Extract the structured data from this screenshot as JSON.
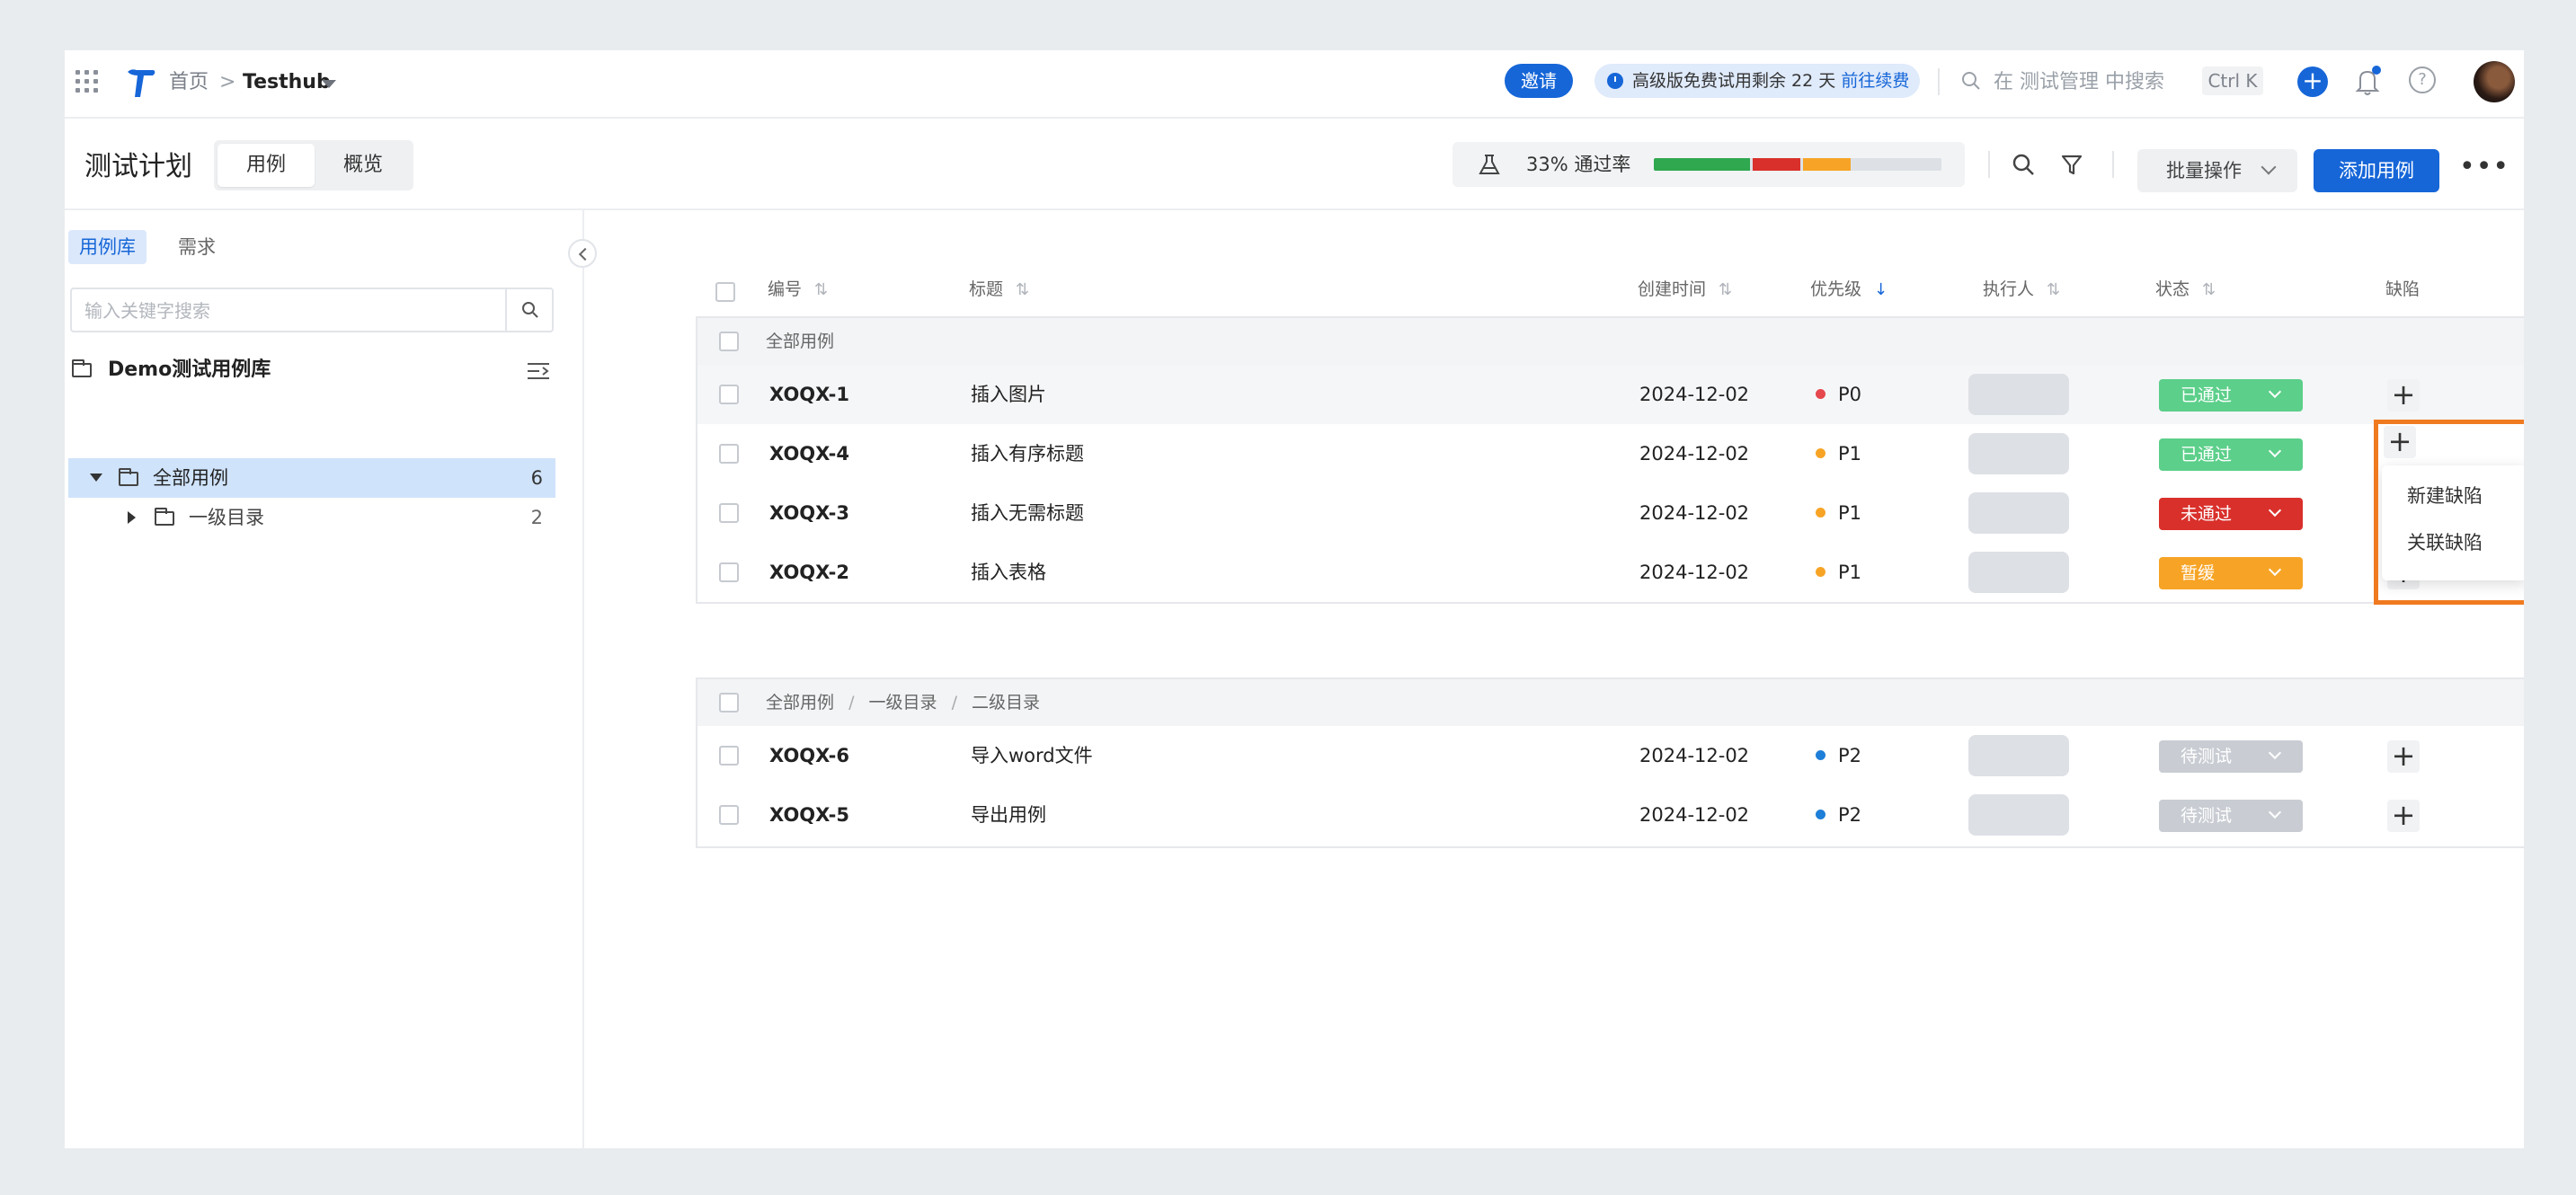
{
  "topnav": {
    "breadcrumb_home": "首页",
    "breadcrumb_sep": ">",
    "project_name": "Testhub",
    "invite_label": "邀请",
    "trial_text": "高级版免费试用剩余 22 天",
    "trial_link": "前往续费",
    "search_placeholder": "在 测试管理 中搜索",
    "shortcut": "Ctrl K",
    "help_label": "?"
  },
  "header": {
    "page_title": "测试计划",
    "tabs": [
      {
        "label": "用例",
        "active": true
      },
      {
        "label": "概览",
        "active": false
      }
    ],
    "pass_rate_label": "33% 通过率",
    "pass_rate": 0.33,
    "pass_bar": [
      {
        "status": "passed",
        "fraction": 0.333,
        "color": "#2fa84f"
      },
      {
        "status": "failed",
        "fraction": 0.167,
        "color": "#d9302b"
      },
      {
        "status": "blocked",
        "fraction": 0.167,
        "color": "#f7a426"
      },
      {
        "status": "untested",
        "fraction": 0.333,
        "color": "#dde1e6"
      }
    ],
    "batch_label": "批量操作",
    "add_label": "添加用例",
    "more_label": "•••"
  },
  "sidebar": {
    "tabs": [
      {
        "label": "用例库",
        "active": true
      },
      {
        "label": "需求",
        "active": false
      }
    ],
    "search_placeholder": "输入关键字搜索",
    "library_title": "Demo测试用例库",
    "tree": [
      {
        "label": "全部用例",
        "count": "6",
        "selected": true,
        "expanded": true
      },
      {
        "label": "一级目录",
        "count": "2",
        "selected": false,
        "expanded": false
      }
    ]
  },
  "table": {
    "columns": {
      "id": "编号",
      "title": "标题",
      "created": "创建时间",
      "priority": "优先级",
      "assignee": "执行人",
      "status": "状态",
      "defect": "缺陷"
    },
    "groups": [
      {
        "path": [
          "全部用例"
        ],
        "rows": [
          {
            "id": "XOQX-1",
            "title": "插入图片",
            "created": "2024-12-02",
            "priority": "P0",
            "priority_color": "#e5484d",
            "status": "已通过",
            "status_color": "#5ccf8a"
          },
          {
            "id": "XOQX-4",
            "title": "插入有序标题",
            "created": "2024-12-02",
            "priority": "P1",
            "priority_color": "#f7a426",
            "status": "已通过",
            "status_color": "#5ccf8a"
          },
          {
            "id": "XOQX-3",
            "title": "插入无需标题",
            "created": "2024-12-02",
            "priority": "P1",
            "priority_color": "#f7a426",
            "status": "未通过",
            "status_color": "#d9302b"
          },
          {
            "id": "XOQX-2",
            "title": "插入表格",
            "created": "2024-12-02",
            "priority": "P1",
            "priority_color": "#f7a426",
            "status": "暂缓",
            "status_color": "#f7a426"
          }
        ]
      },
      {
        "path": [
          "全部用例",
          "一级目录",
          "二级目录"
        ],
        "path_sep": "/",
        "rows": [
          {
            "id": "XOQX-6",
            "title": "导入word文件",
            "created": "2024-12-02",
            "priority": "P2",
            "priority_color": "#1e7fd8",
            "status": "待测试",
            "status_color": "#c9cdd3"
          },
          {
            "id": "XOQX-5",
            "title": "导出用例",
            "created": "2024-12-02",
            "priority": "P2",
            "priority_color": "#1e7fd8",
            "status": "待测试",
            "status_color": "#c9cdd3"
          }
        ]
      }
    ]
  },
  "defect_menu": {
    "items": [
      "新建缺陷",
      "关联缺陷"
    ]
  },
  "colors": {
    "accent": "#1666d8",
    "highlight": "#f07a20"
  }
}
